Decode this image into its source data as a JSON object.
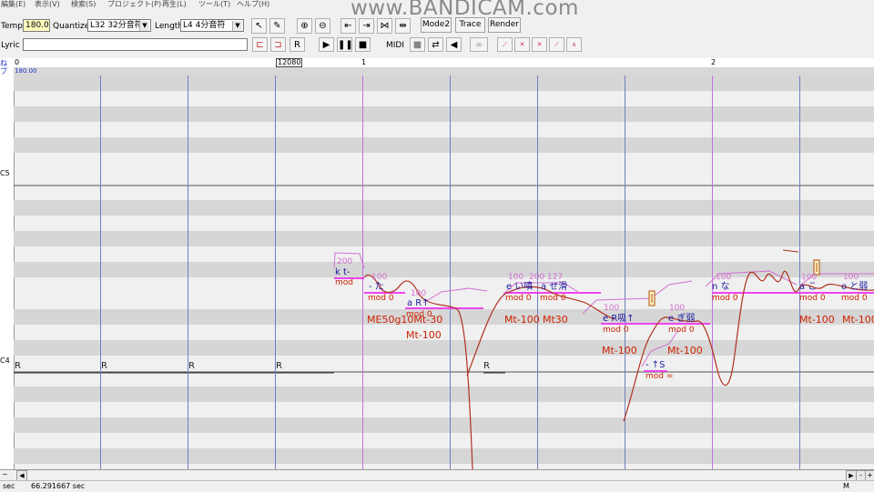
{
  "menu": [
    {
      "label": "編集(E)"
    },
    {
      "label": "表示(V)"
    },
    {
      "label": "検索(S)"
    },
    {
      "label": "プロジェクト(P)"
    },
    {
      "label": "再生(L)"
    },
    {
      "label": "ツール(T)"
    },
    {
      "label": "ヘルプ(H)"
    }
  ],
  "watermark": "www.BANDICAM.com",
  "toolbar": {
    "tempo_label": "Tempo",
    "tempo_value": "180.0",
    "quantize_label": "Quantize",
    "quantize_value": "L32 32分音符",
    "length_label": "Length",
    "length_value": "L4  4分音符",
    "mode2": "Mode2",
    "trace": "Trace",
    "render": "Render",
    "lyric_label": "Lyric",
    "lyric_value": "",
    "midi_label": "MIDI"
  },
  "ruler": {
    "start": "0",
    "position": "12080",
    "measure1": "1",
    "measure2": "2"
  },
  "tempo_marker": "180.00",
  "piano": {
    "c5": "C5",
    "c4": "C4"
  },
  "colors": {
    "accent": "#cc2200",
    "note_line": "#ee44ee",
    "lyric_blue": "#1a1aa0",
    "flag_red": "#cc2200",
    "param_pink": "#d070d0",
    "measure_line": "#c070e0",
    "beat_line": "#7080c0"
  },
  "notes": [
    {
      "lyric": "k t-",
      "vel": "200",
      "mod": "mod"
    },
    {
      "lyric": "- た",
      "vel": "100",
      "mod": "mod 0"
    },
    {
      "lyric": "a R↑",
      "vel": "100",
      "mod": "mod 0"
    },
    {
      "lyric": "e い嗔",
      "vel": "100",
      "mod": "mod 0"
    },
    {
      "lyric": "a せ滑",
      "vel": "200 127",
      "mod": "mod 0"
    },
    {
      "lyric": "e R吸↑",
      "vel": "100",
      "mod": "mod 0"
    },
    {
      "lyric": "e ぎ弱",
      "vel": "100",
      "mod": "mod 0"
    },
    {
      "lyric": "- ↑S",
      "vel": "",
      "mod": "mod ="
    },
    {
      "lyric": "n な",
      "vel": "100",
      "mod": "mod 0"
    },
    {
      "lyric": "a こ",
      "vel": "100",
      "mod": "mod 0"
    },
    {
      "lyric": "o と弱",
      "vel": "100",
      "mod": "mod 0"
    }
  ],
  "flags": [
    "ME50g10Mt-30",
    "Mt-100",
    "Mt-100",
    "Mt30",
    "Mt-100",
    "Mt-100",
    "Mt-100",
    "Mt-100"
  ],
  "rests": [
    "R",
    "R",
    "R",
    "R",
    "R"
  ],
  "status": {
    "label": "sec",
    "time": "66.291667 sec",
    "mode": "M"
  },
  "icons": [
    "arrow-select-icon",
    "pencil-icon",
    "zoom-in-icon",
    "zoom-out-icon",
    "move-left-icon",
    "move-right-icon",
    "shrink-icon",
    "expand-icon",
    "insert-rest-icon",
    "play-icon",
    "pause-icon",
    "stop-icon",
    "speaker-icon"
  ]
}
